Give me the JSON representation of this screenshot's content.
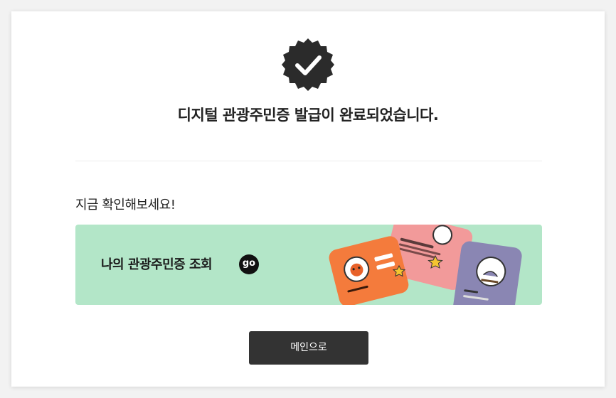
{
  "completion": {
    "title": "디지털 관광주민증 발급이 완료되었습니다."
  },
  "check_section": {
    "subtitle": "지금 확인해보세요!",
    "banner_label": "나의 관광주민증 조회",
    "go_label": "go"
  },
  "actions": {
    "main_button_label": "메인으로"
  },
  "colors": {
    "badge": "#2b2b2b",
    "banner_bg": "#b3e6c8",
    "button_bg": "#333333",
    "card_orange": "#f47b3c",
    "card_pink": "#f29a9a",
    "card_purple": "#8a86b3"
  }
}
